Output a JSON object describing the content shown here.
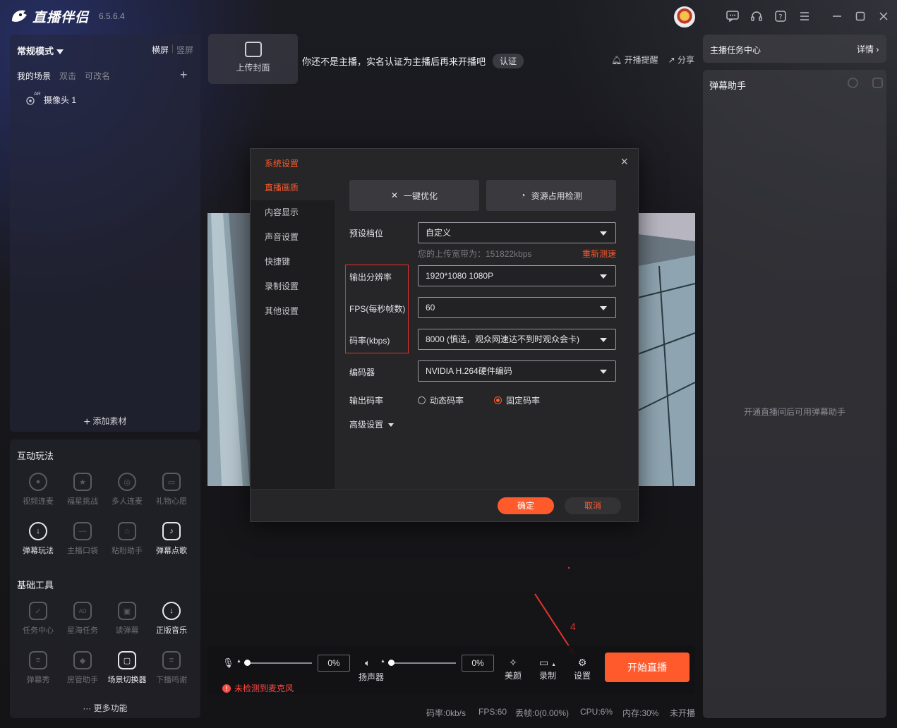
{
  "app": {
    "name": "直播伴侣",
    "version": "6.5.6.4"
  },
  "titlebar": {
    "icons": [
      "message-icon",
      "headset-icon",
      "help-icon",
      "menu-icon",
      "minimize-icon",
      "maximize-icon",
      "close-icon"
    ]
  },
  "left": {
    "mode": "常规模式",
    "orient_landscape": "横屏",
    "orient_portrait": "竖屏",
    "scene_label": "我的场景",
    "scene_hint1": "双击",
    "scene_hint2": "可改名",
    "camera_badge": "AR",
    "camera_item": "摄像头 1",
    "add_material": "添加素材",
    "interactive_title": "互动玩法",
    "interactive": [
      "视频连麦",
      "福星挑战",
      "多人连麦",
      "礼物心愿",
      "弹幕玩法",
      "主播口袋",
      "粘粉助手",
      "弹幕点歌"
    ],
    "basic_title": "基础工具",
    "basic": [
      "任务中心",
      "星海任务",
      "读弹幕",
      "正版音乐",
      "弹幕秀",
      "房管助手",
      "场景切换器",
      "下播鸣谢"
    ],
    "more": "更多功能"
  },
  "header": {
    "upload_cover": "上传封面",
    "notice": "你还不是主播，实名认证为主播后再来开播吧",
    "verify": "认证",
    "remind": "开播提醒",
    "share": "分享"
  },
  "right": {
    "task_center": "主播任务中心",
    "details": "详情",
    "danmu_title": "弹幕助手",
    "danmu_hint": "开通直播间后可用弹幕助手"
  },
  "dialog": {
    "title": "系统设置",
    "nav": [
      "直播画质",
      "内容显示",
      "声音设置",
      "快捷键",
      "录制设置",
      "其他设置"
    ],
    "optimize": "一键优化",
    "resource_check": "资源占用检测",
    "preset_label": "预设档位",
    "preset_value": "自定义",
    "bandwidth": "您的上传宽带为：151822kbps",
    "retest": "重新测速",
    "resolution_label": "输出分辨率",
    "resolution_value": "1920*1080 1080P",
    "fps_label": "FPS(每秒帧数)",
    "fps_value": "60",
    "bitrate_label": "码率(kbps)",
    "bitrate_value": "8000 (慎选，观众网速达不到时观众会卡)",
    "encoder_label": "编码器",
    "encoder_value": "NVIDIA H.264硬件编码",
    "rate_label": "输出码率",
    "rate_dynamic": "动态码率",
    "rate_fixed": "固定码率",
    "advanced": "高级设置",
    "ok": "确定",
    "cancel": "取消"
  },
  "controls": {
    "mic_volume": "0%",
    "speaker_label": "扬声器",
    "speaker_volume": "0%",
    "beauty": "美颜",
    "record": "录制",
    "settings": "设置",
    "start_live": "开始直播",
    "mic_warning": "未检测到麦克风",
    "annotation_number": "4"
  },
  "status": {
    "bitrate": "码率:0kb/s",
    "fps": "FPS:60",
    "drop": "丢帧:0(0.00%)",
    "cpu": "CPU:6%",
    "memory": "内存:30%",
    "live_state": "未开播"
  },
  "colors": {
    "accent": "#ff5a2c",
    "annotation_red": "#e0342c"
  }
}
